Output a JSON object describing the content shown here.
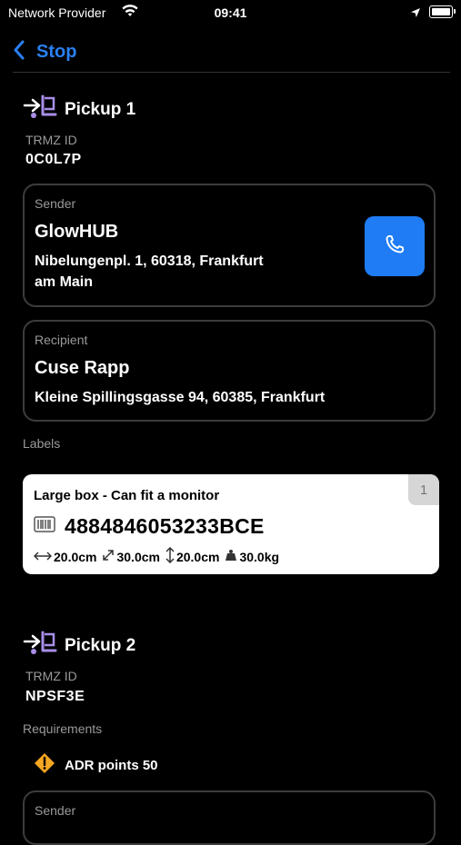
{
  "status_bar": {
    "carrier": "Network Provider",
    "time": "09:41"
  },
  "nav": {
    "back_label": "Stop"
  },
  "pickups": [
    {
      "title": "Pickup 1",
      "id_label": "TRMZ ID",
      "id_value": "0C0L7P",
      "sender": {
        "caption": "Sender",
        "name": "GlowHUB",
        "address_line1": "Nibelungenpl. 1, 60318, Frankfurt",
        "address_line2": "am Main"
      },
      "recipient": {
        "caption": "Recipient",
        "name": "Cuse Rapp",
        "address": "Kleine Spillingsgasse 94, 60385, Frankfurt"
      },
      "labels_heading": "Labels",
      "label": {
        "title": "Large box - Can fit a monitor",
        "count": "1",
        "barcode": "4884846053233BCE",
        "length": "20.0cm",
        "diagonal": "30.0cm",
        "height": "20.0cm",
        "weight": "30.0kg"
      }
    },
    {
      "title": "Pickup 2",
      "id_label": "TRMZ ID",
      "id_value": "NPSF3E",
      "requirements_heading": "Requirements",
      "requirement": "ADR points 50",
      "sender_caption": "Sender"
    }
  ],
  "colors": {
    "accent": "#1f7cf4",
    "back_link": "#2a7ff0",
    "pickup_icon": "#a98ee8",
    "warning": "#f5a623"
  }
}
